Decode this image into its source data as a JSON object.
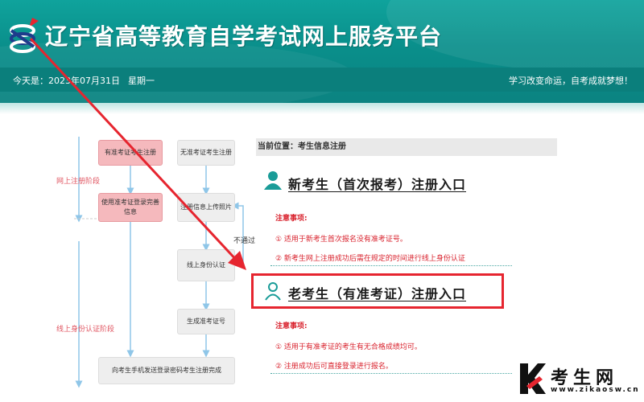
{
  "header": {
    "title": "辽宁省高等教育自学考试网上服务平台",
    "date_label": "今天是：2023年07月31日",
    "weekday": "星期一",
    "slogan": "学习改变命运，自考成就梦想！",
    "brand_color": "#0a8f8b"
  },
  "flowchart": {
    "phase_online": "网上注册阶段",
    "phase_identity": "线上身份认证阶段",
    "box_with_ticket": "有准考证考生注册",
    "box_without_ticket": "无准考证考生注册",
    "box_use_ticket": "使用准考证登录完善信息",
    "box_register_info": "注册信息上传照片",
    "box_identity": "线上身份认证",
    "box_generate": "生成准考证号",
    "box_final": "向考生手机发送登录密码考生注册完成",
    "fail_label": "不通过"
  },
  "breadcrumb": {
    "prefix": "当前位置：",
    "current": "考生信息注册"
  },
  "new_student": {
    "title": "新考生（首次报考）注册入口",
    "notes_title": "注意事项:",
    "note1": "① 适用于新考生首次报名没有准考证号。",
    "note2": "② 新考生网上注册成功后需在规定的时间进行线上身份认证"
  },
  "old_student": {
    "title": "老考生（有准考证）注册入口",
    "notes_title": "注意事项:",
    "note1": "① 适用于有准考证的考生有无合格成绩均可。",
    "note2": "② 注册成功后可直接登录进行报名。"
  },
  "watermark": {
    "name": "考生网",
    "url": "www.zikaosw.cn"
  },
  "colors": {
    "highlight": "#e6252f",
    "note_red": "#d9232e",
    "icon_teal": "#1a9c98"
  }
}
